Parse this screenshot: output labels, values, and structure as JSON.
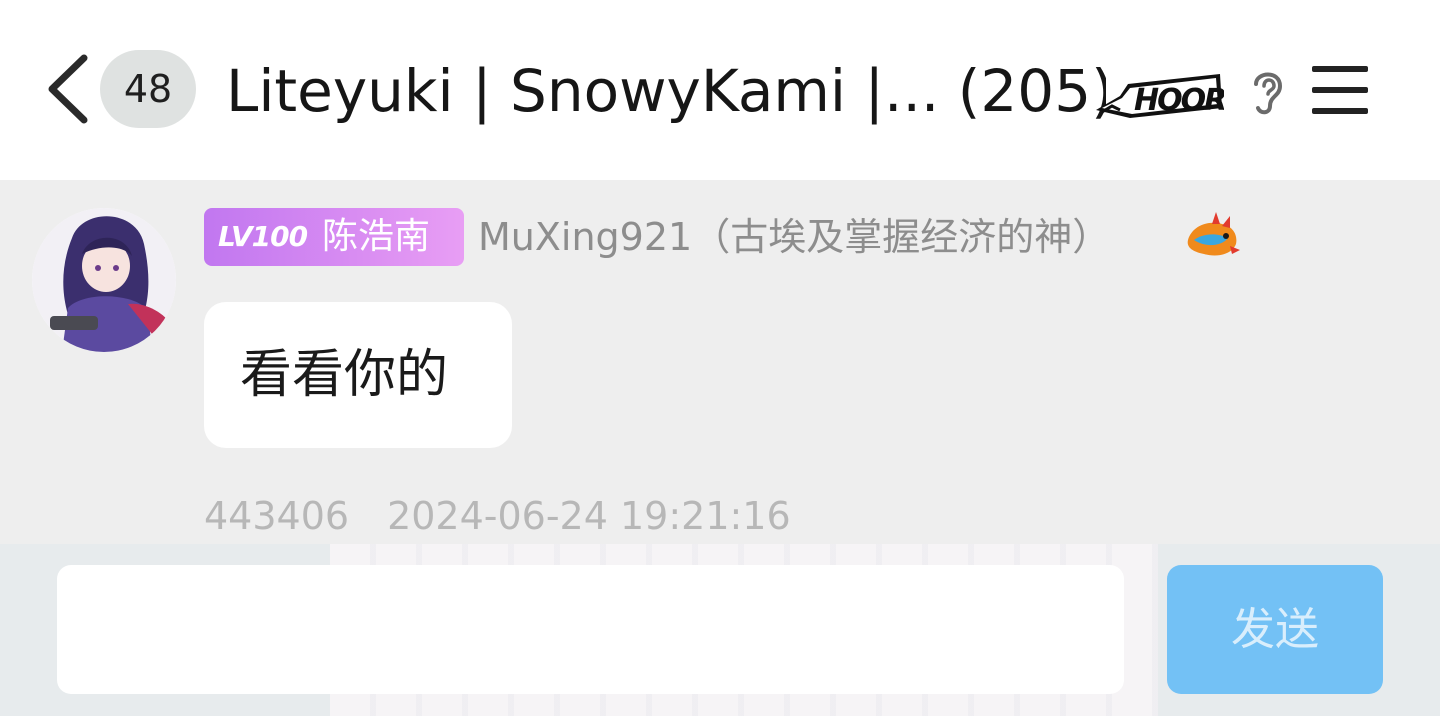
{
  "header": {
    "back_icon": "chevron-left-icon",
    "unread_count": "48",
    "title": "Liteyuki | SnowyKami |... (205)",
    "title_logo_text": "HOORAY",
    "ear_icon": "ear-icon",
    "menu_icon": "hamburger-menu-icon"
  },
  "message": {
    "level_badge": "LV100",
    "title_tag": "陈浩南",
    "sender": "MuXing921（古埃及掌握经济的神）",
    "sender_decoration": "dragon-icon",
    "text": "看看你的",
    "user_id": "443406",
    "timestamp": "2024-06-24 19:21:16"
  },
  "composer": {
    "value": "",
    "placeholder": "",
    "send_label": "发送"
  },
  "colors": {
    "header_bg": "#ffffff",
    "chat_bg": "#eeeeee",
    "badge_bg": "#dfe2e1",
    "level_tag_gradient_start": "#c177f0",
    "level_tag_gradient_end": "#e89ef4",
    "send_button": "#73c1f5",
    "meta_text": "#b7b7b7"
  }
}
